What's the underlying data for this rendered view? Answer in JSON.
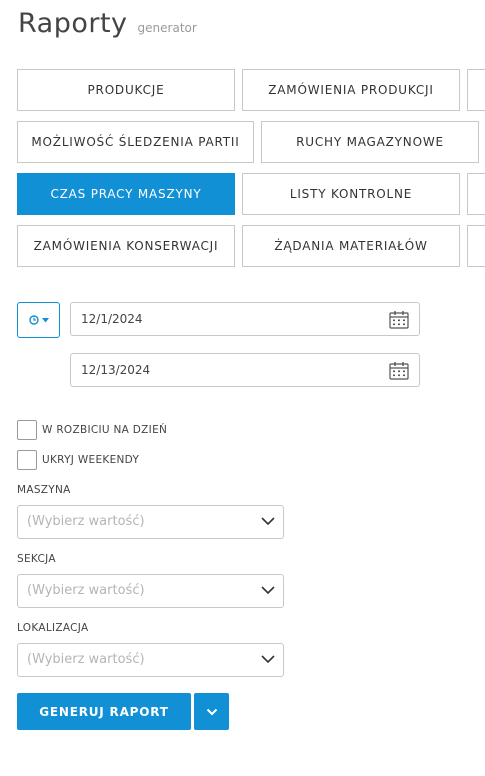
{
  "header": {
    "title": "Raporty",
    "subtitle": "generator"
  },
  "tabs": [
    {
      "label": "PRODUKCJE"
    },
    {
      "label": "ZAMÓWIENIA PRODUKCJI"
    },
    {
      "label": ""
    },
    {
      "label": "MOŻLIWOŚĆ ŚLEDZENIA PARTII"
    },
    {
      "label": "RUCHY MAGAZYNOWE"
    },
    {
      "label": ""
    },
    {
      "label": "CZAS PRACY MASZYNY",
      "active": true
    },
    {
      "label": "LISTY KONTROLNE"
    },
    {
      "label": ""
    },
    {
      "label": "ZAMÓWIENIA KONSERWACJI"
    },
    {
      "label": "ŻĄDANIA MATERIAŁÓW"
    },
    {
      "label": ""
    }
  ],
  "dates": {
    "from": "12/1/2024",
    "to": "12/13/2024"
  },
  "options": {
    "daily_breakdown": "W ROZBICIU NA DZIEŃ",
    "hide_weekends": "UKRYJ WEEKENDY"
  },
  "filters": {
    "machine": {
      "label": "MASZYNA",
      "placeholder": "(Wybierz wartość)"
    },
    "section": {
      "label": "SEKCJA",
      "placeholder": "(Wybierz wartość)"
    },
    "location": {
      "label": "LOKALIZACJA",
      "placeholder": "(Wybierz wartość)"
    }
  },
  "actions": {
    "generate": "GENERUJ RAPORT"
  },
  "colors": {
    "accent": "#1190d6",
    "border": "#c8c8c8"
  },
  "icons": {
    "time_range": "clock-icon",
    "calendar": "calendar-icon",
    "dropdown": "chevron-down-icon"
  }
}
